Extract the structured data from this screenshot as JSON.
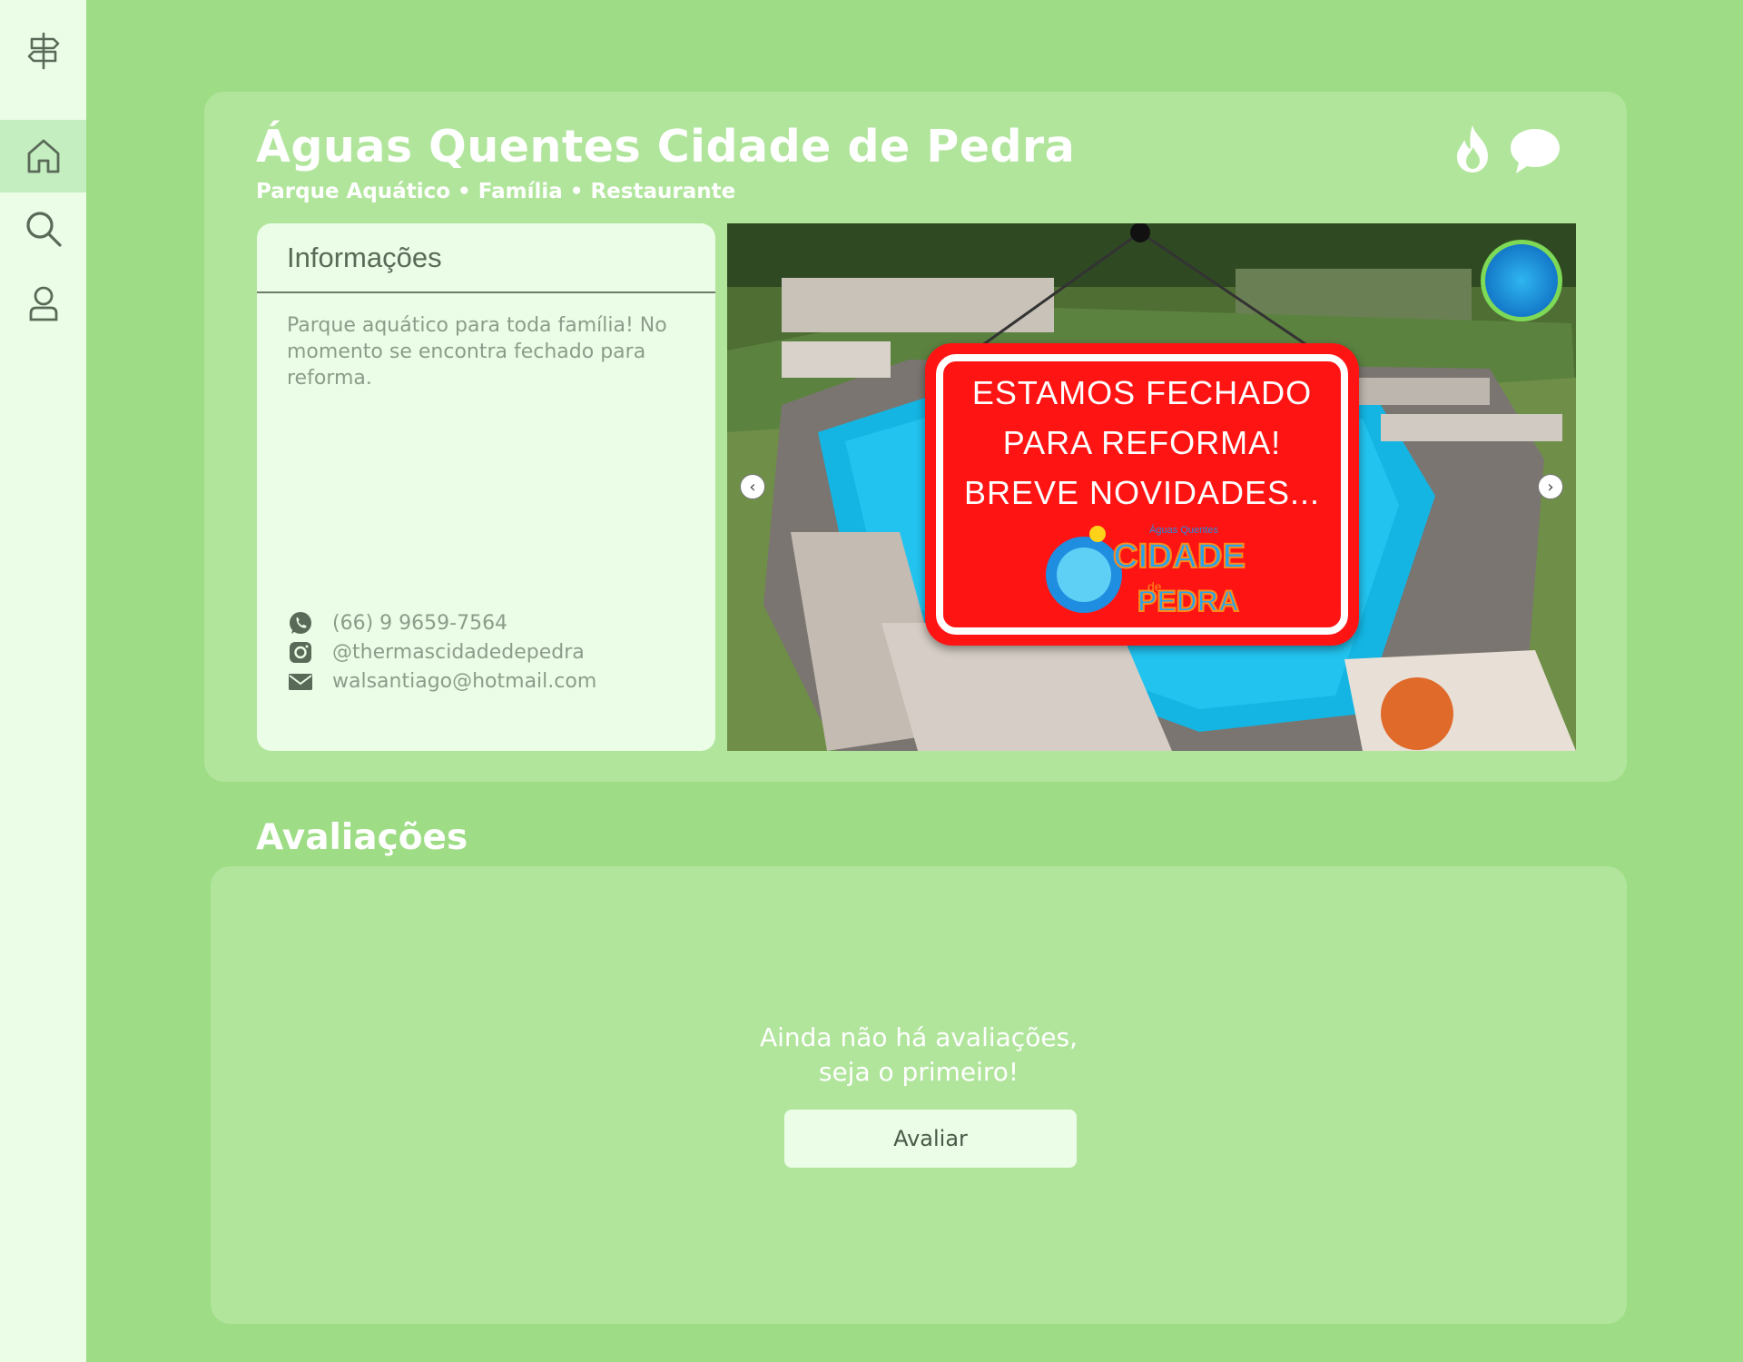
{
  "sidebar": {
    "items": [
      {
        "icon": "signpost-icon"
      },
      {
        "icon": "home-icon",
        "active": true
      },
      {
        "icon": "search-icon"
      },
      {
        "icon": "user-icon"
      }
    ]
  },
  "place": {
    "title": "Águas Quentes Cidade de Pedra",
    "subtitle": "Parque Aquático • Família • Restaurante",
    "actions": [
      "flame-icon",
      "chat-bubble-icon"
    ]
  },
  "info": {
    "heading": "Informações",
    "description": "Parque aquático para toda família! No momento se encontra fechado para reforma.",
    "contacts": [
      {
        "icon": "whatsapp-icon",
        "text": "(66) 9 9659-7564"
      },
      {
        "icon": "instagram-icon",
        "text": "@thermascidadedepedra"
      },
      {
        "icon": "mail-icon",
        "text": "walsantiago@hotmail.com"
      }
    ]
  },
  "photo": {
    "sign_lines": [
      "ESTAMOS FECHADO",
      "PARA REFORMA!",
      "BREVE NOVIDADES..."
    ],
    "logo_text": [
      "Águas Quentes",
      "CIDADE",
      "de",
      "PEDRA"
    ],
    "prev_icon": "chevron-left-icon",
    "next_icon": "chevron-right-icon"
  },
  "reviews": {
    "title": "Avaliações",
    "empty_line1": "Ainda não há avaliações,",
    "empty_line2": "seja o primeiro!",
    "button_label": "Avaliar"
  },
  "colors": {
    "background": "#9edd86",
    "card": "#b1e59c",
    "sidebar": "#ebfde6",
    "sidebar_active": "#c4eec0",
    "icon": "#5a6a58"
  }
}
